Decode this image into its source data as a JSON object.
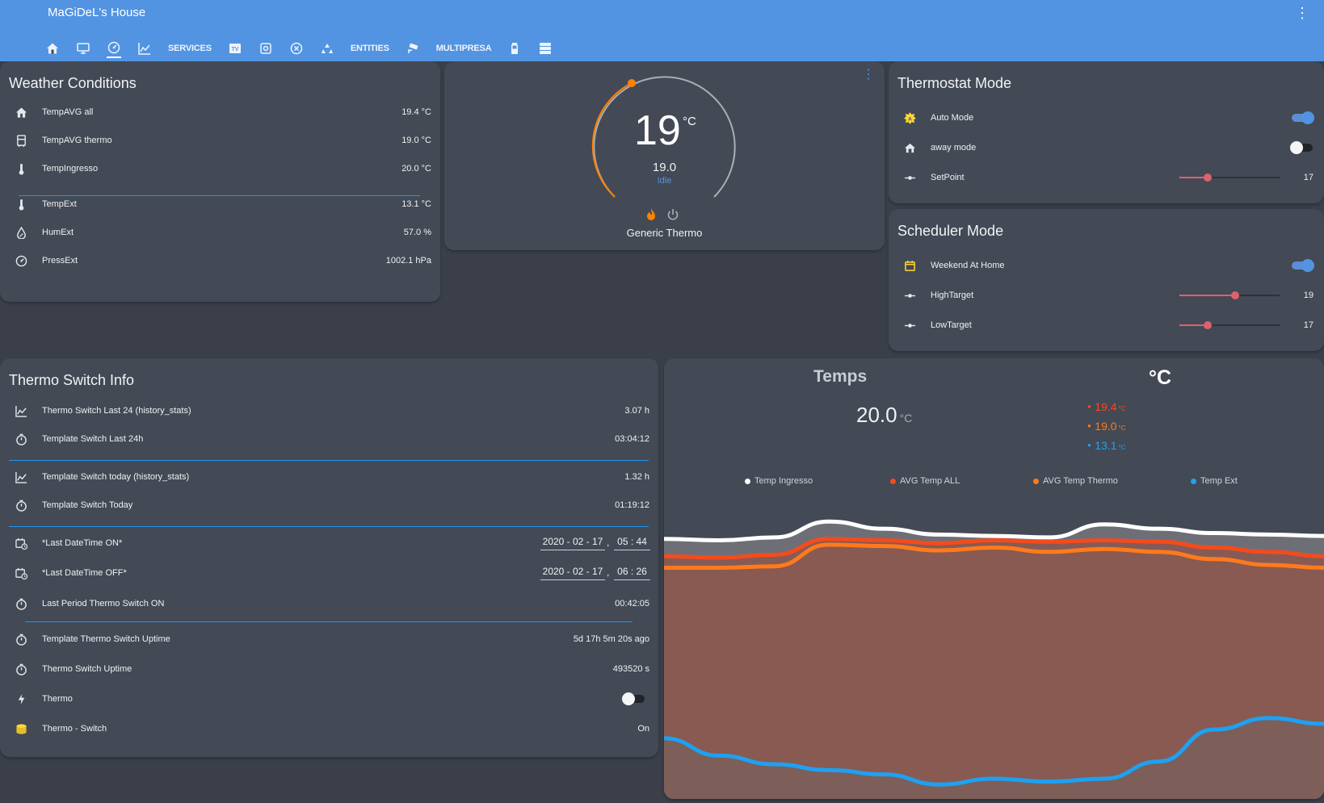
{
  "app": {
    "title": "MaGiDeL's House"
  },
  "tabs": [
    {
      "kind": "icon",
      "icon": "home-icon"
    },
    {
      "kind": "icon",
      "icon": "monitor-icon"
    },
    {
      "kind": "icon",
      "icon": "gauge-icon",
      "active": true
    },
    {
      "kind": "icon",
      "icon": "chart-line-icon"
    },
    {
      "kind": "text",
      "label": "SERVICES"
    },
    {
      "kind": "icon",
      "icon": "tv-icon"
    },
    {
      "kind": "icon",
      "icon": "scan-icon"
    },
    {
      "kind": "icon",
      "icon": "close-circle-icon"
    },
    {
      "kind": "icon",
      "icon": "recycle-icon"
    },
    {
      "kind": "text",
      "label": "ENTITIES"
    },
    {
      "kind": "icon",
      "icon": "cctv-icon"
    },
    {
      "kind": "text",
      "label": "MULTIPRESA"
    },
    {
      "kind": "icon",
      "icon": "battery-icon"
    },
    {
      "kind": "icon",
      "icon": "server-icon"
    }
  ],
  "weather": {
    "title": "Weather Conditions",
    "rows": [
      {
        "icon": "home-icon",
        "label": "TempAVG all",
        "value": "19.4 °C"
      },
      {
        "icon": "radiator-icon",
        "label": "TempAVG thermo",
        "value": "19.0 °C"
      },
      {
        "icon": "thermometer-icon",
        "label": "TempIngresso",
        "value": "20.0 °C"
      },
      {
        "icon": "thermometer-icon",
        "label": "TempExt",
        "value": "13.1 °C"
      },
      {
        "icon": "water-percent-icon",
        "label": "HumExt",
        "value": "57.0 %"
      },
      {
        "icon": "gauge-icon",
        "label": "PressExt",
        "value": "1002.1 hPa"
      }
    ]
  },
  "thermostat": {
    "temperature": "19",
    "unit": "°C",
    "target": "19.0",
    "action": "Idle",
    "name": "Generic Thermo",
    "colors": {
      "heat": "#ff8100",
      "idle_text": "#5294e2"
    }
  },
  "thermostat_mode": {
    "title": "Thermostat Mode",
    "auto": {
      "label": "Auto Mode",
      "on": true
    },
    "away": {
      "label": "away mode",
      "on": false
    },
    "setpoint": {
      "label": "SetPoint",
      "value": "17",
      "fraction": 0.28
    }
  },
  "scheduler": {
    "title": "Scheduler Mode",
    "weekend": {
      "label": "Weekend At Home",
      "on": true
    },
    "high": {
      "label": "HighTarget",
      "value": "19",
      "fraction": 0.56
    },
    "low": {
      "label": "LowTarget",
      "value": "17",
      "fraction": 0.28
    }
  },
  "switch_info": {
    "title": "Thermo Switch Info",
    "rows": [
      {
        "icon": "chart-line-icon",
        "label": "Thermo Switch Last 24 (history_stats)",
        "value": "3.07 h"
      },
      {
        "icon": "timer-icon",
        "label": "Template Switch Last 24h",
        "value": "03:04:12"
      },
      {
        "icon": "chart-line-icon",
        "label": "Template Switch today (history_stats)",
        "value": "1.32 h"
      },
      {
        "icon": "timer-icon",
        "label": "Template Switch Today",
        "value": "01:19:12"
      }
    ],
    "dt_on": {
      "label": "*Last DateTime ON*",
      "date": "2020 - 02 - 17",
      "time": "05 : 44"
    },
    "dt_off": {
      "label": "*Last DateTime OFF*",
      "date": "2020 - 02 - 17",
      "time": "06 : 26"
    },
    "last_period": {
      "label": "Last Period Thermo Switch ON",
      "value": "00:42:05"
    },
    "uptime_rows": [
      {
        "icon": "timer-icon",
        "label": "Template Thermo Switch Uptime",
        "value": "5d 17h 5m 20s ago"
      },
      {
        "icon": "timer-icon",
        "label": "Thermo Switch Uptime",
        "value": "493520 s"
      }
    ],
    "thermo": {
      "label": "Thermo",
      "on": false
    },
    "thermo_switch": {
      "label": "Thermo - Switch",
      "value": "On"
    },
    "separator": ","
  },
  "chart_data": {
    "type": "area",
    "title": "Temps",
    "unit": "°C",
    "main_value": "20.0",
    "main_unit": "°C",
    "secondary": [
      {
        "value": "19.4",
        "unit": "°C",
        "color": "#f44b1d"
      },
      {
        "value": "19.0",
        "unit": "°C",
        "color": "#ff7a1d"
      },
      {
        "value": "13.1",
        "unit": "°C",
        "color": "#1ea1f2"
      }
    ],
    "ylim": [
      11,
      21.5
    ],
    "series": [
      {
        "name": "Temp Ingresso",
        "color": "#ffffff",
        "values": [
          20.0,
          19.95,
          20.05,
          20.6,
          20.35,
          20.15,
          20.1,
          20.05,
          20.5,
          20.35,
          20.2,
          20.15,
          20.1
        ]
      },
      {
        "name": "AVG Temp ALL",
        "color": "#f44b1d",
        "values": [
          19.4,
          19.35,
          19.45,
          20.0,
          19.95,
          19.85,
          19.95,
          19.9,
          19.95,
          19.9,
          19.7,
          19.55,
          19.4
        ]
      },
      {
        "name": "AVG Temp Thermo",
        "color": "#ff7a1d",
        "values": [
          19.0,
          19.0,
          19.05,
          19.8,
          19.75,
          19.6,
          19.7,
          19.55,
          19.65,
          19.55,
          19.3,
          19.1,
          19.0
        ]
      },
      {
        "name": "Temp Ext",
        "color": "#1ea1f2",
        "values": [
          13.1,
          12.5,
          12.2,
          12.0,
          11.85,
          11.5,
          11.7,
          11.6,
          11.7,
          12.3,
          13.4,
          13.8,
          13.6
        ]
      }
    ]
  }
}
